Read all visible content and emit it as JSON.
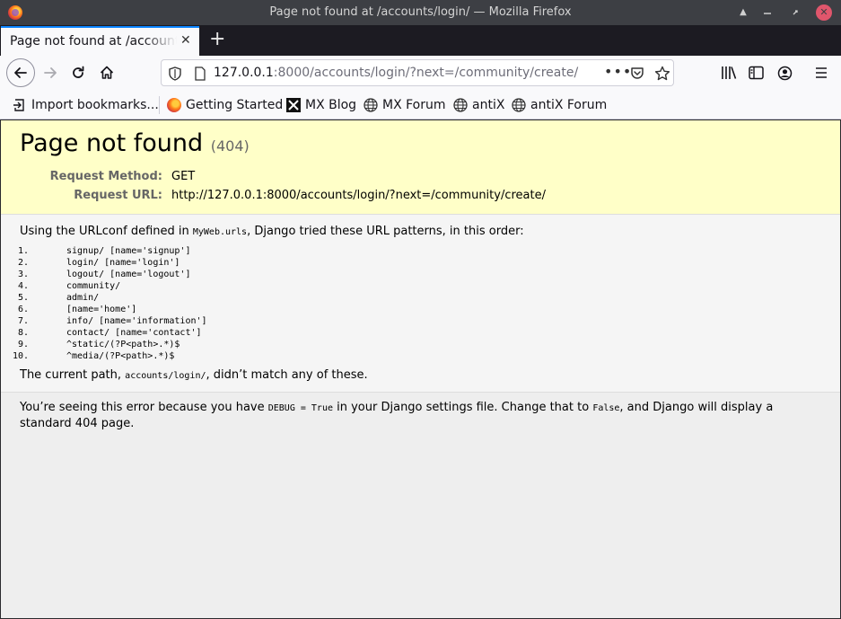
{
  "window": {
    "title": "Page not found at /accounts/login/ — Mozilla Firefox"
  },
  "tab": {
    "label": "Page not found at /accounts/login/",
    "close": "✕",
    "new_tab": "+"
  },
  "urlbar": {
    "host": "127.0.0.1",
    "rest": ":8000/accounts/login/?next=/community/create/",
    "more": "•••"
  },
  "bookmarks": [
    {
      "label": "Import bookmarks...",
      "icon": "import-icon"
    },
    {
      "label": "Getting Started",
      "icon": "firefox-icon"
    },
    {
      "label": "MX Blog",
      "icon": "mx-icon"
    },
    {
      "label": "MX Forum",
      "icon": "globe-icon"
    },
    {
      "label": "antiX",
      "icon": "globe-icon"
    },
    {
      "label": "antiX Forum",
      "icon": "globe-icon"
    }
  ],
  "page": {
    "heading": "Page not found",
    "status_code": "(404)",
    "request_method_label": "Request Method:",
    "request_method": "GET",
    "request_url_label": "Request URL:",
    "request_url": "http://127.0.0.1:8000/accounts/login/?next=/community/create/",
    "intro_pre": "Using the URLconf defined in ",
    "urlconf": "MyWeb.urls",
    "intro_post": ", Django tried these URL patterns, in this order:",
    "patterns": [
      {
        "num": "1.",
        "text": "signup/ [name='signup']"
      },
      {
        "num": "2.",
        "text": "login/ [name='login']"
      },
      {
        "num": "3.",
        "text": "logout/ [name='logout']"
      },
      {
        "num": "4.",
        "text": "community/"
      },
      {
        "num": "5.",
        "text": "admin/"
      },
      {
        "num": "6.",
        "text": "[name='home']"
      },
      {
        "num": "7.",
        "text": "info/ [name='information']"
      },
      {
        "num": "8.",
        "text": "contact/ [name='contact']"
      },
      {
        "num": "9.",
        "text": "^static/(?P<path>.*)$"
      },
      {
        "num": "10.",
        "text": "^media/(?P<path>.*)$"
      }
    ],
    "current_pre": "The current path, ",
    "current_path": "accounts/login/",
    "current_post": ", didn’t match any of these.",
    "explain_1": "You’re seeing this error because you have ",
    "debug_code": "DEBUG = True",
    "explain_2": " in your Django settings file. Change that to ",
    "false_code": "False",
    "explain_3": ", and Django will display a standard 404 page."
  }
}
